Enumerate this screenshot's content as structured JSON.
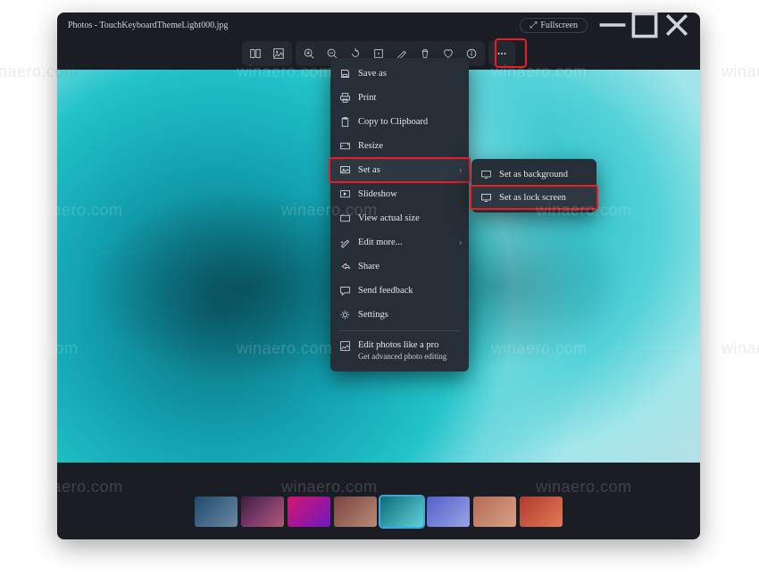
{
  "title": "Photos - TouchKeyboardThemeLight000.jpg",
  "fullscreen_label": "Fullscreen",
  "toolbar": {
    "compare": "compare-icon",
    "edit": "edit-icon",
    "zoom_in": "zoom-in-icon",
    "zoom_out": "zoom-out-icon",
    "rotate": "rotate-icon",
    "crop": "crop-icon",
    "markup": "markup-icon",
    "delete": "delete-icon",
    "favorite": "favorite-icon",
    "info": "info-icon",
    "more": "more-icon"
  },
  "menu": {
    "save_as": "Save as",
    "print": "Print",
    "copy_clipboard": "Copy to Clipboard",
    "resize": "Resize",
    "set_as": "Set as",
    "slideshow": "Slideshow",
    "view_actual": "View actual size",
    "edit_more": "Edit more...",
    "share": "Share",
    "send_feedback": "Send feedback",
    "settings": "Settings",
    "promo_title": "Edit photos like a pro",
    "promo_sub": "Get advanced photo editing"
  },
  "submenu": {
    "background": "Set as background",
    "lockscreen": "Set as lock screen"
  },
  "watermark_text": "winaero.com"
}
